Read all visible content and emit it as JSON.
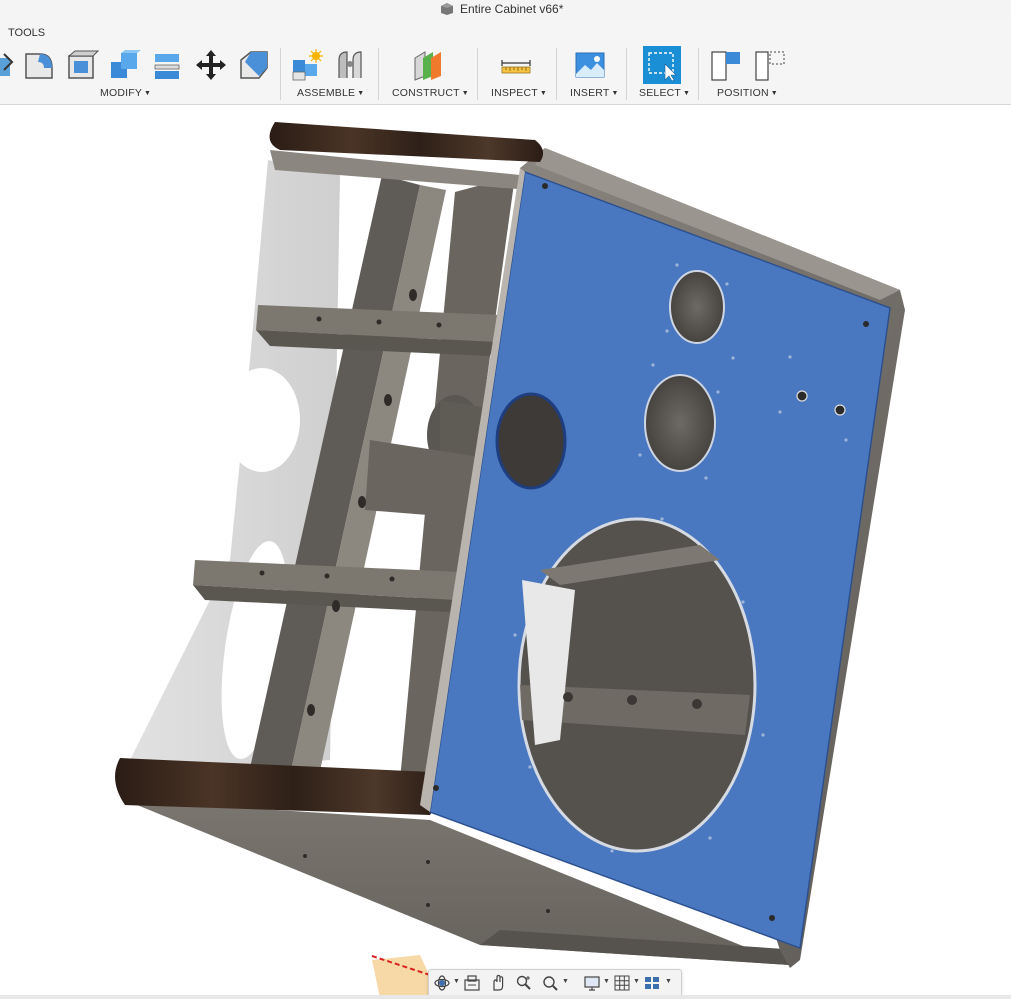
{
  "window": {
    "title": "Entire Cabinet v66*"
  },
  "ribbon": {
    "tools_tab": "TOOLS",
    "groups": {
      "modify": "MODIFY",
      "assemble": "ASSEMBLE",
      "construct": "CONSTRUCT",
      "inspect": "INSPECT",
      "insert": "INSERT",
      "select": "SELECT",
      "position": "POSITION"
    },
    "dropdown_caret": "▼"
  },
  "icons": {
    "modify": [
      "press-pull-icon",
      "fillet-icon",
      "shell-icon",
      "combine-icon",
      "split-body-icon",
      "move-icon",
      "chamfer-icon"
    ],
    "assemble": [
      "new-component-icon",
      "joint-icon"
    ],
    "construct": [
      "offset-plane-icon"
    ],
    "inspect": [
      "measure-icon"
    ],
    "insert": [
      "insert-image-icon"
    ],
    "select": [
      "window-select-icon"
    ],
    "position": [
      "capture-position-icon",
      "revert-position-icon"
    ],
    "navbar": [
      "orbit-icon",
      "look-at-icon",
      "pan-icon",
      "zoom-icon",
      "fit-icon",
      "display-settings-icon",
      "grid-icon",
      "viewports-icon"
    ]
  },
  "colors": {
    "accent": "#1b8fd6",
    "selected_face": "#4a78c0",
    "cabinet_gray": "#6e6a64",
    "wood": "#3a2a20"
  }
}
